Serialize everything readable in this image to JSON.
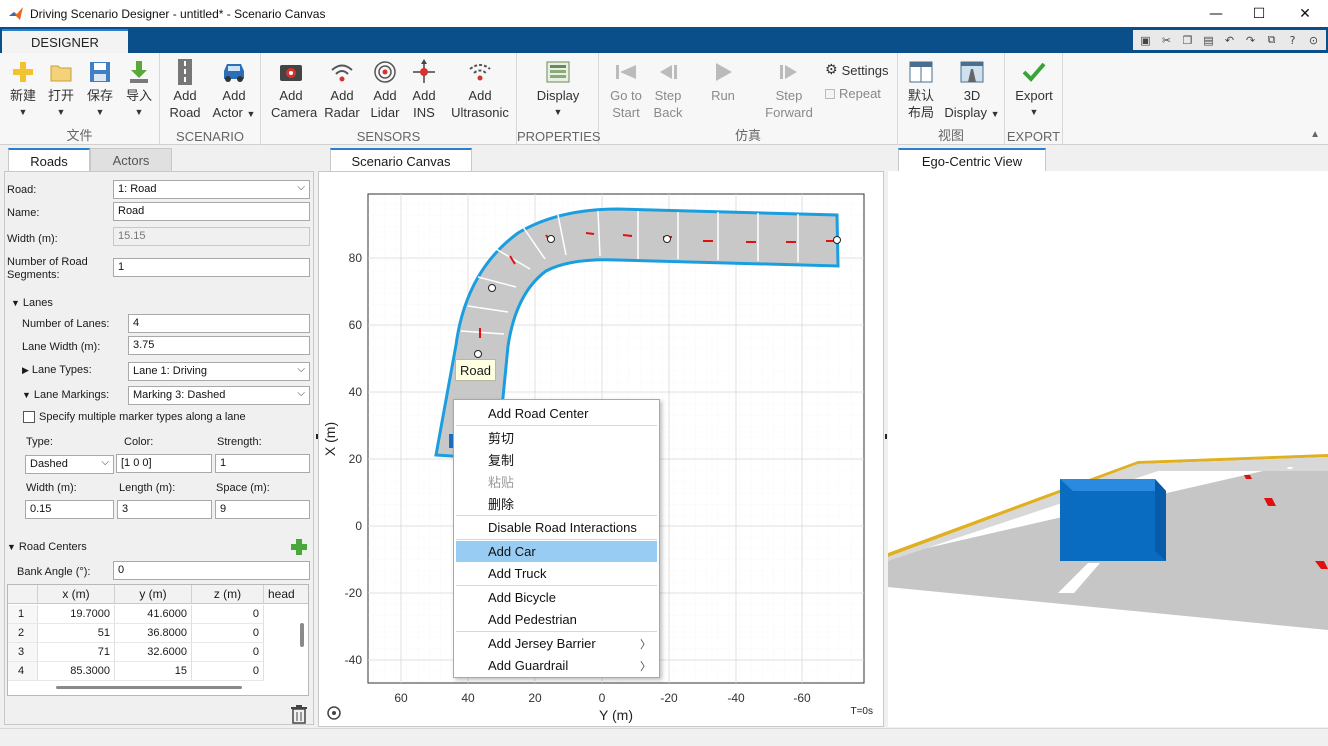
{
  "window": {
    "title": "Driving Scenario Designer - untitled* - Scenario Canvas",
    "minimize_glyph": "—",
    "maximize_glyph": "☐",
    "close_glyph": "✕"
  },
  "ribbon_tab": "DESIGNER",
  "ribbon": {
    "file": {
      "label": "文件",
      "new": "新建",
      "open": "打开",
      "save": "保存",
      "import": "导入"
    },
    "scenario": {
      "label": "SCENARIO",
      "add_road_1": "Add",
      "add_road_2": "Road",
      "add_actor_1": "Add",
      "add_actor_2": "Actor"
    },
    "sensors": {
      "label": "SENSORS",
      "camera_1": "Add",
      "camera_2": "Camera",
      "radar_1": "Add",
      "radar_2": "Radar",
      "lidar_1": "Add",
      "lidar_2": "Lidar",
      "ins_1": "Add",
      "ins_2": "INS",
      "ultrasonic_1": "Add",
      "ultrasonic_2": "Ultrasonic"
    },
    "properties": {
      "label": "PROPERTIES",
      "display": "Display"
    },
    "simulate": {
      "label": "仿真",
      "go_to_start_1": "Go to",
      "go_to_start_2": "Start",
      "step_back_1": "Step",
      "step_back_2": "Back",
      "run": "Run",
      "step_forward_1": "Step",
      "step_forward_2": "Forward",
      "settings": "Settings",
      "repeat": "Repeat"
    },
    "view": {
      "label": "视图",
      "default_layout_1": "默认",
      "default_layout_2": "布局",
      "display_3d_1": "3D",
      "display_3d_2": "Display"
    },
    "export": {
      "label": "EXPORT",
      "export": "Export"
    }
  },
  "left_tabs": {
    "roads": "Roads",
    "actors": "Actors"
  },
  "road_props": {
    "road_label": "Road:",
    "road_value": "1: Road",
    "name_label": "Name:",
    "name_value": "Road",
    "width_label": "Width (m):",
    "width_value": "15.15",
    "segments_label_1": "Number of Road",
    "segments_label_2": "Segments:",
    "segments_value": "1",
    "lanes_section": "Lanes",
    "num_lanes_label": "Number of Lanes:",
    "num_lanes_value": "4",
    "lane_width_label": "Lane Width (m):",
    "lane_width_value": "3.75",
    "lane_types_label": "Lane Types:",
    "lane_types_value": "Lane 1: Driving",
    "lane_markings_label": "Lane Markings:",
    "lane_markings_value": "Marking 3: Dashed",
    "multi_marker_label": "Specify multiple marker types along a lane",
    "type_label": "Type:",
    "type_value": "Dashed",
    "color_label": "Color:",
    "color_value": "[1 0 0]",
    "strength_label": "Strength:",
    "strength_value": "1",
    "mwidth_label": "Width (m):",
    "mwidth_value": "0.15",
    "length_label": "Length (m):",
    "length_value": "3",
    "space_label": "Space (m):",
    "space_value": "9",
    "road_centers_section": "Road Centers",
    "bank_angle_label": "Bank Angle (°):",
    "bank_angle_value": "0"
  },
  "road_centers_table": {
    "columns": [
      "x (m)",
      "y (m)",
      "z (m)",
      "head"
    ],
    "rows": [
      {
        "idx": "1",
        "x": "19.7000",
        "y": "41.6000",
        "z": "0"
      },
      {
        "idx": "2",
        "x": "51",
        "y": "36.8000",
        "z": "0"
      },
      {
        "idx": "3",
        "x": "71",
        "y": "32.6000",
        "z": "0"
      },
      {
        "idx": "4",
        "x": "85.3000",
        "y": "15",
        "z": "0"
      }
    ]
  },
  "canvas": {
    "tab": "Scenario Canvas",
    "xlabel": "Y (m)",
    "ylabel": "X (m)",
    "x_ticks": [
      "60",
      "40",
      "20",
      "0",
      "-20",
      "-40",
      "-60"
    ],
    "y_ticks": [
      "80",
      "60",
      "40",
      "20",
      "0",
      "-20",
      "-40"
    ],
    "time": "T=0s",
    "tooltip": "Road"
  },
  "context_menu": {
    "add_road_center": "Add Road Center",
    "cut": "剪切",
    "copy": "复制",
    "paste": "粘贴",
    "delete": "删除",
    "disable_road_interactions": "Disable Road Interactions",
    "add_car": "Add Car",
    "add_truck": "Add Truck",
    "add_bicycle": "Add Bicycle",
    "add_pedestrian": "Add Pedestrian",
    "add_jersey_barrier": "Add Jersey Barrier",
    "add_guardrail": "Add Guardrail"
  },
  "ego_view": {
    "tab": "Ego-Centric View"
  },
  "colors": {
    "accent": "#2a7fd0",
    "tabstrip": "#0b4f8a",
    "road_outline": "#1a9ee0",
    "lane_red": "#e01010",
    "car_blue": "#0a6cc0",
    "menu_highlight": "#99ccf3"
  }
}
